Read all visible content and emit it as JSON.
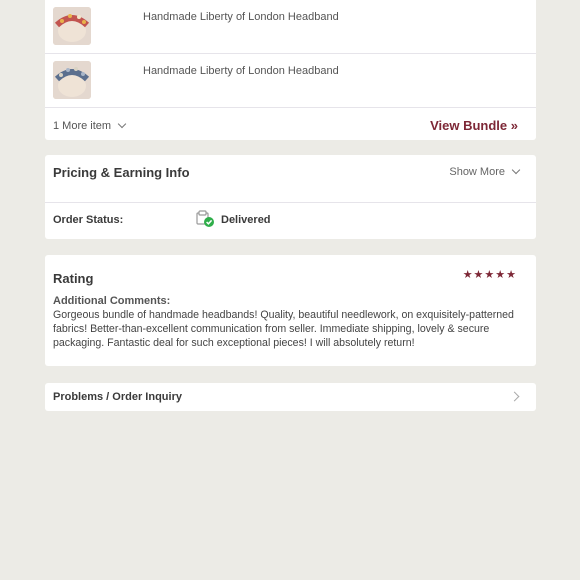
{
  "bundle": {
    "items": [
      {
        "title": "Handmade Liberty of London Headband",
        "thumb": "headband-red-floral"
      },
      {
        "title": "Handmade Liberty of London Headband",
        "thumb": "headband-blue-floral"
      }
    ],
    "more_label": "1 More item",
    "view_bundle_label": "View Bundle »"
  },
  "pricing": {
    "title": "Pricing & Earning Info",
    "show_more_label": "Show More"
  },
  "order_status": {
    "label": "Order Status:",
    "value": "Delivered",
    "icon": "delivered-check-icon"
  },
  "rating": {
    "title": "Rating",
    "stars": "★★★★★",
    "star_count": 5,
    "comments_label": "Additional Comments:",
    "comments": "Gorgeous bundle of handmade headbands! Quality, beautiful needlework, on exquisitely-patterned fabrics! Better-than-excellent communication from seller. Immediate shipping, lovely & secure packaging. Fantastic deal for such exceptional pieces! I will absolutely return!"
  },
  "problems": {
    "label": "Problems / Order Inquiry"
  },
  "colors": {
    "accent": "#7d2736",
    "background": "#ecebe6",
    "delivered": "#2fae4a"
  }
}
